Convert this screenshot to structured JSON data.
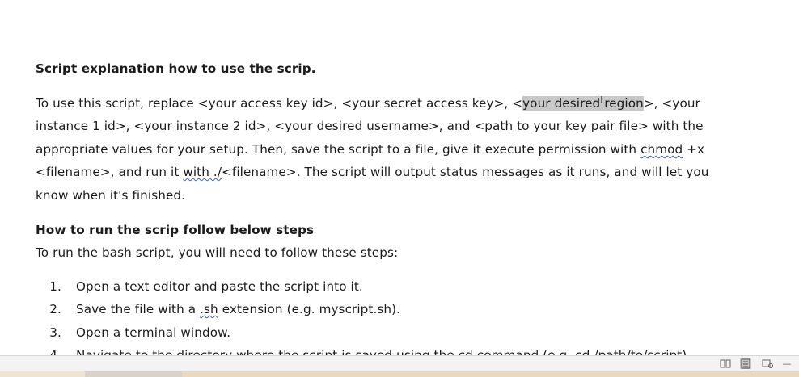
{
  "document": {
    "heading1": "Script explanation how to use the scrip.",
    "para1": {
      "l1_a": "To use this script, replace <your access key id>, <your secret access key>, ",
      "l1_sel_a": "<",
      "l1_sel_b": "your desired region",
      "l1_b": ">, <your",
      "l2": "instance 1 id>, <your instance 2 id>, <your desired username>, and <path to your key pair file> with the",
      "l3_a": "appropriate values for your setup. Then, save the script to a file, give it execute permission with ",
      "l3_sq": "chmod",
      "l3_b": " +x",
      "l4_a": "<filename>, and run it ",
      "l4_sq": "with ./",
      "l4_b": "<filename>. The script will output status messages as it runs, and will let you",
      "l5": "know when it's finished."
    },
    "heading2": "How to run the scrip follow below steps",
    "intro": "To run the bash script, you will need to follow these steps:",
    "steps": [
      {
        "num": "1.",
        "text": "Open a text editor and paste the script into it."
      },
      {
        "num": "2.",
        "pre": "Save the file with a ",
        "sq": ".sh",
        "post": " extension (e.g. myscript.sh)."
      },
      {
        "num": "3.",
        "text": "Open a terminal window."
      },
      {
        "num": "4.",
        "text": "Navigate to the directory where the script is saved using the cd command (e.g. cd /path/to/script)"
      }
    ]
  },
  "statusbar": {
    "icons": [
      "read-mode-icon",
      "print-layout-icon",
      "web-layout-icon"
    ],
    "zoom_minus": "—"
  },
  "colors": {
    "selection": "#c8c8c8",
    "squiggle": "#3a5fcd"
  }
}
